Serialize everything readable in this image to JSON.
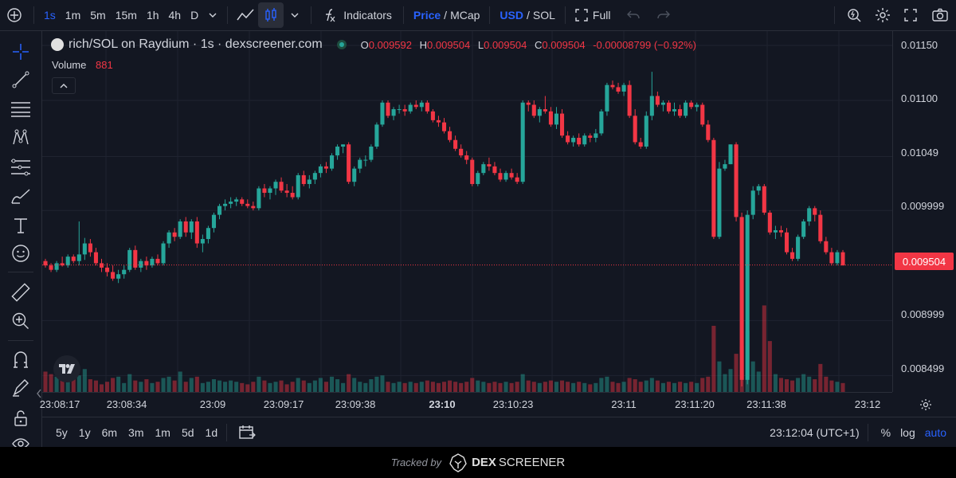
{
  "toolbar": {
    "timeframes": [
      "1s",
      "1m",
      "5m",
      "15m",
      "1h",
      "4h",
      "D"
    ],
    "active_timeframe": "1s",
    "indicators_label": "Indicators",
    "price_label": "Price",
    "mcap_label": "MCap",
    "usd_label": "USD",
    "sol_label": "SOL",
    "full_label": "Full"
  },
  "legend": {
    "symbol": "rich/SOL on Raydium · 1s · dexscreener.com",
    "o_key": "O",
    "o_val": "0.009592",
    "h_key": "H",
    "h_val": "0.009504",
    "l_key": "L",
    "l_val": "0.009504",
    "c_key": "C",
    "c_val": "0.009504",
    "change": "-0.00008799 (−0.92%)",
    "volume_label": "Volume",
    "volume_value": "881"
  },
  "colors": {
    "up": "#26a69a",
    "down": "#f23645",
    "accent": "#2962ff",
    "background": "#131722"
  },
  "price_axis": {
    "labels": [
      "0.01150",
      "0.01100",
      "0.01049",
      "0.009999",
      "0.008999",
      "0.008499"
    ],
    "last_price": "0.009504"
  },
  "time_axis": {
    "labels": [
      "23:08:17",
      "23:08:34",
      "23:09",
      "23:09:17",
      "23:09:38",
      "23:10",
      "23:10:23",
      "23:11",
      "23:11:20",
      "23:11:38",
      "23:12"
    ]
  },
  "bottom": {
    "ranges": [
      "5y",
      "1y",
      "6m",
      "3m",
      "1m",
      "5d",
      "1d"
    ],
    "clock": "23:12:04 (UTC+1)",
    "percent_label": "%",
    "log_label": "log",
    "auto_label": "auto"
  },
  "footer": {
    "tracked_by": "Tracked by",
    "brand_dex": "DEX",
    "brand_screener": "SCREENER"
  },
  "chart_data": {
    "type": "candlestick",
    "title": "rich/SOL on Raydium · 1s · dexscreener.com",
    "ylim": [
      0.00835,
      0.01163
    ],
    "y_ticks": [
      0.0115,
      0.011,
      0.01049,
      0.009999,
      0.008999,
      0.008499
    ],
    "last_price": 0.009504,
    "candles": [
      [
        0.00954,
        0.00956,
        0.00948,
        0.0095,
        80
      ],
      [
        0.0095,
        0.00952,
        0.00944,
        0.00946,
        70
      ],
      [
        0.00946,
        0.00954,
        0.00944,
        0.00952,
        60
      ],
      [
        0.00952,
        0.00958,
        0.00949,
        0.0095,
        50
      ],
      [
        0.0095,
        0.0096,
        0.00948,
        0.00958,
        40
      ],
      [
        0.00958,
        0.0096,
        0.00952,
        0.00954,
        55
      ],
      [
        0.00954,
        0.0099,
        0.0095,
        0.0096,
        65
      ],
      [
        0.0096,
        0.00975,
        0.00955,
        0.0097,
        90
      ],
      [
        0.0097,
        0.00974,
        0.00958,
        0.00962,
        50
      ],
      [
        0.00962,
        0.00966,
        0.0095,
        0.00952,
        45
      ],
      [
        0.00952,
        0.00956,
        0.00944,
        0.00948,
        30
      ],
      [
        0.00948,
        0.00952,
        0.0094,
        0.00944,
        40
      ],
      [
        0.00944,
        0.0095,
        0.00936,
        0.00938,
        55
      ],
      [
        0.00938,
        0.00946,
        0.00934,
        0.00942,
        60
      ],
      [
        0.00942,
        0.0095,
        0.00938,
        0.00946,
        35
      ],
      [
        0.00946,
        0.00966,
        0.00944,
        0.00964,
        70
      ],
      [
        0.00964,
        0.00968,
        0.00946,
        0.00948,
        45
      ],
      [
        0.00948,
        0.00956,
        0.00944,
        0.00954,
        40
      ],
      [
        0.00954,
        0.00958,
        0.00946,
        0.0095,
        50
      ],
      [
        0.0095,
        0.00958,
        0.00948,
        0.00956,
        35
      ],
      [
        0.00956,
        0.0096,
        0.0095,
        0.00952,
        40
      ],
      [
        0.00952,
        0.00972,
        0.0095,
        0.0097,
        55
      ],
      [
        0.0097,
        0.00982,
        0.00966,
        0.0098,
        60
      ],
      [
        0.0098,
        0.00984,
        0.00972,
        0.00976,
        45
      ],
      [
        0.00976,
        0.00992,
        0.00974,
        0.0099,
        80
      ],
      [
        0.0099,
        0.00994,
        0.00976,
        0.0098,
        40
      ],
      [
        0.0098,
        0.00992,
        0.00974,
        0.0099,
        55
      ],
      [
        0.0099,
        0.00994,
        0.00966,
        0.0097,
        60
      ],
      [
        0.0097,
        0.00978,
        0.00962,
        0.00974,
        35
      ],
      [
        0.00974,
        0.00986,
        0.0097,
        0.00984,
        40
      ],
      [
        0.00984,
        0.00998,
        0.0098,
        0.00996,
        50
      ],
      [
        0.00996,
        0.01006,
        0.00992,
        0.01004,
        45
      ],
      [
        0.01004,
        0.0101,
        0.01,
        0.01006,
        40
      ],
      [
        0.01006,
        0.01012,
        0.01002,
        0.01008,
        45
      ],
      [
        0.01008,
        0.01012,
        0.01004,
        0.0101,
        40
      ],
      [
        0.0101,
        0.01012,
        0.01004,
        0.01006,
        35
      ],
      [
        0.01006,
        0.0101,
        0.01002,
        0.01004,
        30
      ],
      [
        0.01004,
        0.01008,
        0.01,
        0.01002,
        40
      ],
      [
        0.01002,
        0.01022,
        0.01,
        0.0102,
        60
      ],
      [
        0.0102,
        0.01024,
        0.01012,
        0.01016,
        45
      ],
      [
        0.01016,
        0.01022,
        0.0101,
        0.0102,
        35
      ],
      [
        0.0102,
        0.01028,
        0.01014,
        0.01026,
        40
      ],
      [
        0.01026,
        0.0103,
        0.01016,
        0.01018,
        45
      ],
      [
        0.01018,
        0.01024,
        0.01012,
        0.01016,
        30
      ],
      [
        0.01016,
        0.01022,
        0.0101,
        0.01012,
        40
      ],
      [
        0.01012,
        0.01034,
        0.0101,
        0.01032,
        55
      ],
      [
        0.01032,
        0.01036,
        0.01022,
        0.01024,
        45
      ],
      [
        0.01024,
        0.01032,
        0.0102,
        0.01028,
        35
      ],
      [
        0.01028,
        0.01036,
        0.01024,
        0.01034,
        45
      ],
      [
        0.01034,
        0.01042,
        0.0103,
        0.0104,
        55
      ],
      [
        0.0104,
        0.01044,
        0.01034,
        0.01038,
        40
      ],
      [
        0.01038,
        0.01052,
        0.01036,
        0.0105,
        60
      ],
      [
        0.0105,
        0.0106,
        0.01046,
        0.01058,
        50
      ],
      [
        0.01058,
        0.0106,
        0.01052,
        0.0106,
        35
      ],
      [
        0.0106,
        0.01062,
        0.01024,
        0.01026,
        70
      ],
      [
        0.01026,
        0.0104,
        0.01022,
        0.01038,
        55
      ],
      [
        0.01038,
        0.01048,
        0.01034,
        0.01046,
        40
      ],
      [
        0.01046,
        0.0105,
        0.0104,
        0.01046,
        35
      ],
      [
        0.01046,
        0.0106,
        0.01044,
        0.01058,
        50
      ],
      [
        0.01058,
        0.0108,
        0.01056,
        0.01078,
        60
      ],
      [
        0.01078,
        0.011,
        0.01076,
        0.01098,
        65
      ],
      [
        0.01098,
        0.011,
        0.01084,
        0.01086,
        40
      ],
      [
        0.01086,
        0.01094,
        0.01082,
        0.01092,
        35
      ],
      [
        0.01092,
        0.01096,
        0.01088,
        0.01092,
        40
      ],
      [
        0.01092,
        0.01096,
        0.01086,
        0.0109,
        35
      ],
      [
        0.0109,
        0.01098,
        0.01088,
        0.01096,
        40
      ],
      [
        0.01096,
        0.011,
        0.01092,
        0.01094,
        35
      ],
      [
        0.01094,
        0.011,
        0.0109,
        0.01098,
        40
      ],
      [
        0.01098,
        0.011,
        0.01088,
        0.0109,
        45
      ],
      [
        0.0109,
        0.01092,
        0.0108,
        0.01082,
        40
      ],
      [
        0.01082,
        0.01086,
        0.01076,
        0.0108,
        35
      ],
      [
        0.0108,
        0.01084,
        0.0107,
        0.01072,
        40
      ],
      [
        0.01072,
        0.01076,
        0.01062,
        0.01064,
        45
      ],
      [
        0.01064,
        0.01068,
        0.01054,
        0.01056,
        40
      ],
      [
        0.01056,
        0.0106,
        0.01048,
        0.0105,
        35
      ],
      [
        0.0105,
        0.01054,
        0.01042,
        0.01046,
        40
      ],
      [
        0.01046,
        0.01048,
        0.01022,
        0.01024,
        55
      ],
      [
        0.01024,
        0.01036,
        0.01022,
        0.01034,
        45
      ],
      [
        0.01034,
        0.01044,
        0.01032,
        0.01042,
        40
      ],
      [
        0.01042,
        0.01048,
        0.01036,
        0.0104,
        35
      ],
      [
        0.0104,
        0.01044,
        0.01032,
        0.01034,
        40
      ],
      [
        0.01034,
        0.01038,
        0.01026,
        0.01028,
        35
      ],
      [
        0.01028,
        0.01036,
        0.01026,
        0.01034,
        40
      ],
      [
        0.01034,
        0.01038,
        0.01028,
        0.0103,
        35
      ],
      [
        0.0103,
        0.01034,
        0.01024,
        0.01026,
        40
      ],
      [
        0.01026,
        0.011,
        0.01024,
        0.01098,
        70
      ],
      [
        0.01098,
        0.011,
        0.0109,
        0.01096,
        45
      ],
      [
        0.01096,
        0.011,
        0.01084,
        0.01086,
        40
      ],
      [
        0.01086,
        0.01094,
        0.0108,
        0.01092,
        35
      ],
      [
        0.01092,
        0.01104,
        0.01088,
        0.0109,
        40
      ],
      [
        0.0109,
        0.01094,
        0.01076,
        0.01078,
        45
      ],
      [
        0.01078,
        0.01094,
        0.01074,
        0.01088,
        40
      ],
      [
        0.01088,
        0.01092,
        0.01066,
        0.01068,
        45
      ],
      [
        0.01068,
        0.01072,
        0.0106,
        0.01062,
        40
      ],
      [
        0.01062,
        0.01068,
        0.01058,
        0.01066,
        35
      ],
      [
        0.01066,
        0.0107,
        0.01058,
        0.0106,
        40
      ],
      [
        0.0106,
        0.0107,
        0.01058,
        0.01068,
        35
      ],
      [
        0.01068,
        0.0107,
        0.01062,
        0.01066,
        30
      ],
      [
        0.01066,
        0.01074,
        0.01062,
        0.0107,
        35
      ],
      [
        0.0107,
        0.01092,
        0.01068,
        0.0109,
        55
      ],
      [
        0.0109,
        0.01116,
        0.01086,
        0.01114,
        60
      ],
      [
        0.01114,
        0.01118,
        0.0111,
        0.01112,
        40
      ],
      [
        0.01112,
        0.01116,
        0.01106,
        0.01108,
        35
      ],
      [
        0.01108,
        0.01116,
        0.01104,
        0.01114,
        40
      ],
      [
        0.01114,
        0.01118,
        0.01084,
        0.01086,
        55
      ],
      [
        0.01086,
        0.01092,
        0.0106,
        0.01062,
        50
      ],
      [
        0.01062,
        0.01066,
        0.01056,
        0.01058,
        40
      ],
      [
        0.01058,
        0.0109,
        0.01056,
        0.01086,
        45
      ],
      [
        0.01086,
        0.01126,
        0.01082,
        0.01104,
        55
      ],
      [
        0.01104,
        0.01108,
        0.01094,
        0.01096,
        45
      ],
      [
        0.01096,
        0.011,
        0.0109,
        0.01098,
        35
      ],
      [
        0.01098,
        0.011,
        0.01088,
        0.0109,
        40
      ],
      [
        0.0109,
        0.01098,
        0.01086,
        0.01092,
        35
      ],
      [
        0.01092,
        0.01096,
        0.01084,
        0.01086,
        40
      ],
      [
        0.01086,
        0.011,
        0.01084,
        0.01098,
        35
      ],
      [
        0.01098,
        0.011,
        0.01092,
        0.01094,
        40
      ],
      [
        0.01094,
        0.01098,
        0.0109,
        0.01096,
        35
      ],
      [
        0.01096,
        0.01098,
        0.01076,
        0.01078,
        55
      ],
      [
        0.01078,
        0.01082,
        0.01062,
        0.01064,
        60
      ],
      [
        0.01064,
        0.01066,
        0.00974,
        0.00976,
        260
      ],
      [
        0.00976,
        0.01044,
        0.00974,
        0.01038,
        120
      ],
      [
        0.01038,
        0.01046,
        0.01036,
        0.01042,
        70
      ],
      [
        0.01042,
        0.01048,
        0.01052,
        0.0106,
        90
      ],
      [
        0.0106,
        0.01062,
        0.0099,
        0.00994,
        150
      ],
      [
        0.00994,
        0.00998,
        0.0084,
        0.00846,
        180
      ],
      [
        0.00846,
        0.01,
        0.00842,
        0.00996,
        240
      ],
      [
        0.00996,
        0.01022,
        0.00992,
        0.01018,
        120
      ],
      [
        0.01018,
        0.01024,
        0.01014,
        0.01022,
        80
      ],
      [
        0.01022,
        0.01024,
        0.00996,
        0.00998,
        340
      ],
      [
        0.00998,
        0.01,
        0.00978,
        0.0098,
        200
      ],
      [
        0.0098,
        0.00986,
        0.00974,
        0.00982,
        70
      ],
      [
        0.00982,
        0.00986,
        0.00976,
        0.0098,
        55
      ],
      [
        0.0098,
        0.00984,
        0.0096,
        0.00962,
        50
      ],
      [
        0.00962,
        0.00966,
        0.00954,
        0.00956,
        45
      ],
      [
        0.00956,
        0.00978,
        0.00954,
        0.00976,
        55
      ],
      [
        0.00976,
        0.00992,
        0.00974,
        0.0099,
        70
      ],
      [
        0.0099,
        0.01004,
        0.00986,
        0.01002,
        60
      ],
      [
        0.01002,
        0.01004,
        0.0099,
        0.00996,
        50
      ],
      [
        0.00996,
        0.01,
        0.0097,
        0.00972,
        110
      ],
      [
        0.00972,
        0.00976,
        0.0096,
        0.00962,
        60
      ],
      [
        0.00962,
        0.00966,
        0.0095,
        0.00952,
        45
      ],
      [
        0.00952,
        0.00964,
        0.0095,
        0.00962,
        40
      ],
      [
        0.00962,
        0.00964,
        0.0095,
        0.0095,
        35
      ]
    ]
  }
}
